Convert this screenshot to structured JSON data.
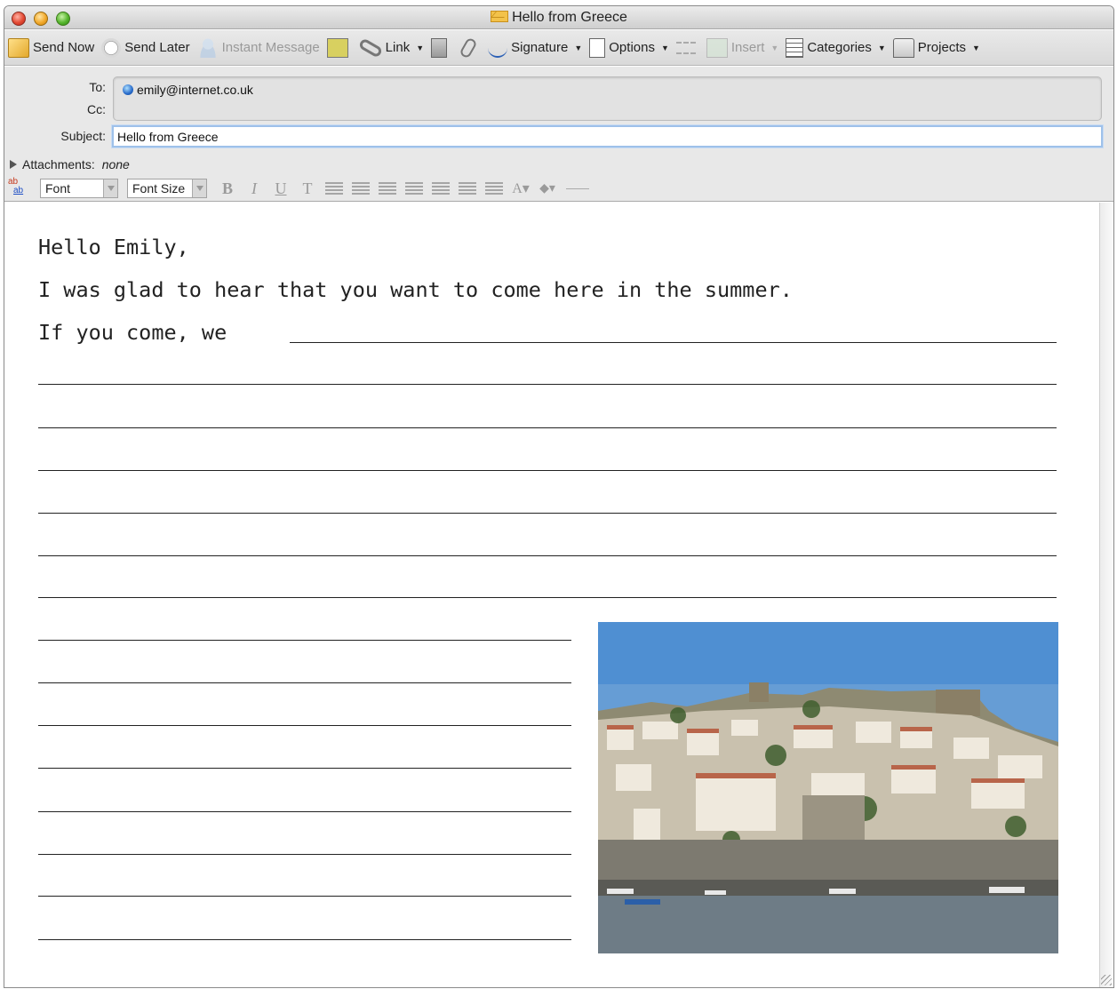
{
  "window": {
    "title": "Hello from Greece"
  },
  "toolbar": {
    "items": [
      {
        "label": "Send Now",
        "icon": "send-now-icon",
        "enabled": true,
        "menu": false
      },
      {
        "label": "Send Later",
        "icon": "send-later-icon",
        "enabled": true,
        "menu": false
      },
      {
        "label": "Instant Message",
        "icon": "instant-message-icon",
        "enabled": false,
        "menu": false
      },
      {
        "label": "",
        "icon": "save-icon",
        "enabled": true,
        "menu": false
      },
      {
        "label": "Link",
        "icon": "link-icon",
        "enabled": true,
        "menu": true
      },
      {
        "label": "",
        "icon": "delete-icon",
        "enabled": true,
        "menu": false
      },
      {
        "label": "",
        "icon": "attachment-icon",
        "enabled": true,
        "menu": false
      },
      {
        "label": "Signature",
        "icon": "signature-icon",
        "enabled": true,
        "menu": true
      },
      {
        "label": "Options",
        "icon": "options-icon",
        "enabled": true,
        "menu": true
      },
      {
        "label": "",
        "icon": "format-icon",
        "enabled": false,
        "menu": false
      },
      {
        "label": "Insert",
        "icon": "insert-icon",
        "enabled": false,
        "menu": true
      },
      {
        "label": "Categories",
        "icon": "categories-icon",
        "enabled": true,
        "menu": true
      },
      {
        "label": "Projects",
        "icon": "projects-icon",
        "enabled": true,
        "menu": true
      }
    ]
  },
  "header": {
    "to_label": "To:",
    "cc_label": "Cc:",
    "subject_label": "Subject:",
    "to_recipient": "emily@internet.co.uk",
    "subject_value": "Hello from Greece",
    "attachments_label": "Attachments:",
    "attachments_value": "none"
  },
  "format_bar": {
    "font_label": "Font",
    "font_size_label": "Font Size",
    "bold": "B",
    "italic": "I",
    "underline": "U",
    "text": "T"
  },
  "message": {
    "line1": "Hello Emily,",
    "line2": "I was glad to hear that you want to come here in the summer.",
    "line3": "If you come, we"
  },
  "photo": {
    "icon": "greece-harbour-town-photo"
  }
}
